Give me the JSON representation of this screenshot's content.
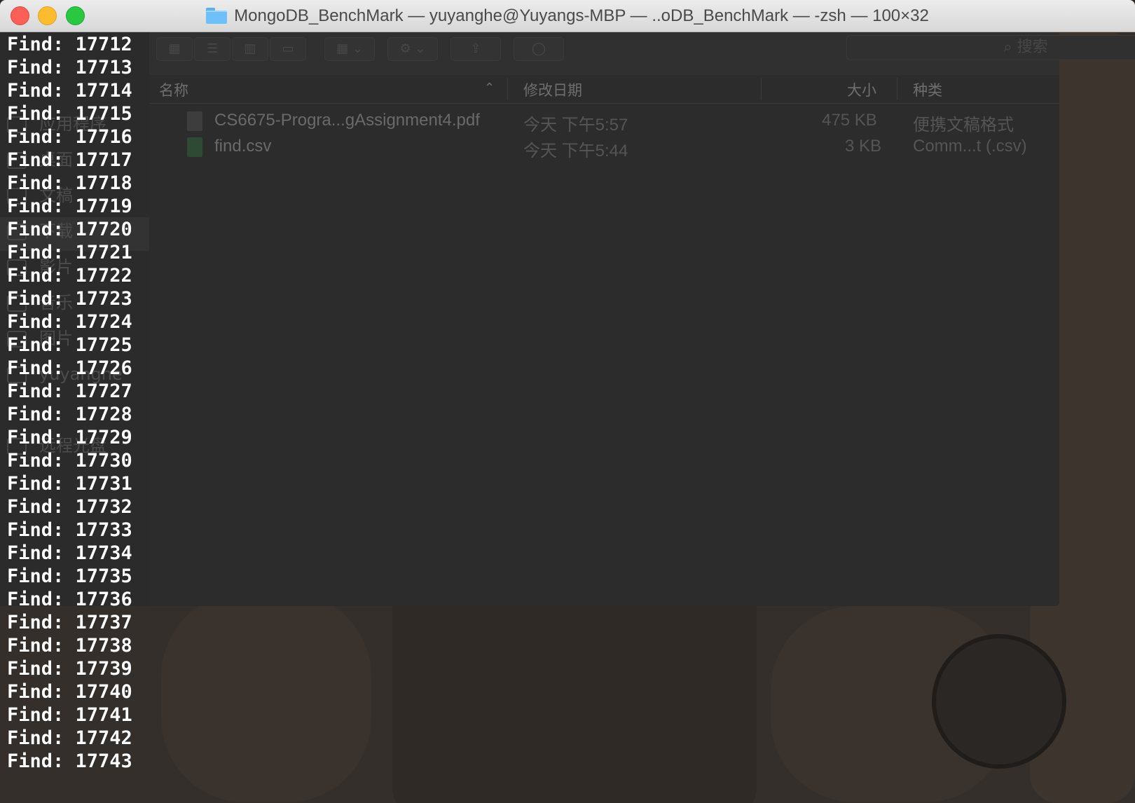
{
  "window": {
    "title": "MongoDB_BenchMark — yuyanghe@Yuyangs-MBP — ..oDB_BenchMark — -zsh — 100×32"
  },
  "finder": {
    "search_placeholder": "搜索",
    "columns": {
      "name": "名称",
      "date": "修改日期",
      "size": "大小",
      "kind": "种类"
    },
    "files": [
      {
        "name": "CS6675-Progra...gAssignment4.pdf",
        "date": "今天 下午5:57",
        "size": "475 KB",
        "kind": "便携文稿格式",
        "icon": "pdf-icon"
      },
      {
        "name": "find.csv",
        "date": "今天 下午5:44",
        "size": "3 KB",
        "kind": "Comm...t (.csv)",
        "icon": "csv-icon"
      }
    ],
    "sidebar": [
      "应用程序",
      "桌面",
      "文稿",
      "下载",
      "影片",
      "音乐",
      "图片",
      "yuyanghe",
      "远程光盘"
    ]
  },
  "terminal": {
    "lines": [
      "Find: 17712",
      "Find: 17713",
      "Find: 17714",
      "Find: 17715",
      "Find: 17716",
      "Find: 17717",
      "Find: 17718",
      "Find: 17719",
      "Find: 17720",
      "Find: 17721",
      "Find: 17722",
      "Find: 17723",
      "Find: 17724",
      "Find: 17725",
      "Find: 17726",
      "Find: 17727",
      "Find: 17728",
      "Find: 17729",
      "Find: 17730",
      "Find: 17731",
      "Find: 17732",
      "Find: 17733",
      "Find: 17734",
      "Find: 17735",
      "Find: 17736",
      "Find: 17737",
      "Find: 17738",
      "Find: 17739",
      "Find: 17740",
      "Find: 17741",
      "Find: 17742",
      "Find: 17743"
    ]
  },
  "colors": {
    "titlebar": "#e0e0e0",
    "terminal_text": "#ffffff",
    "close": "#fc5f57",
    "minimize": "#fdbc2e",
    "maximize": "#28c840"
  }
}
